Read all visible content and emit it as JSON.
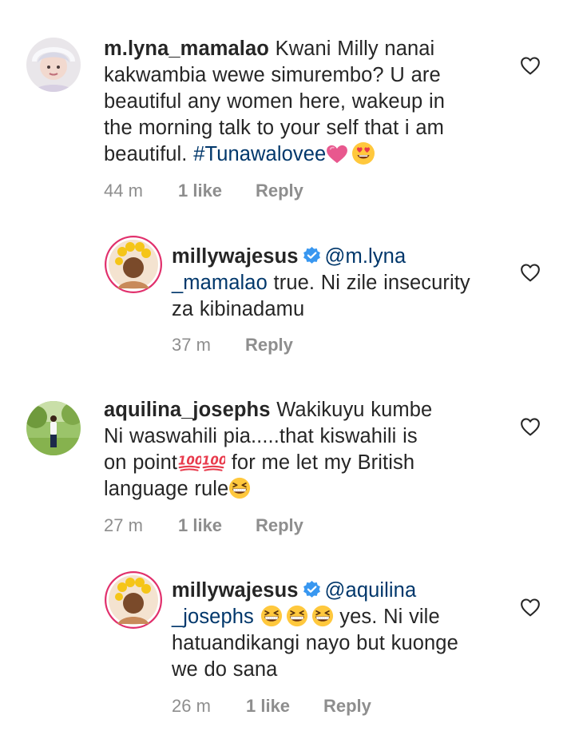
{
  "comments": [
    {
      "username": "m.lyna_mamalao",
      "lines": [
        "Kwani Milly nanai",
        "kakwambia wewe simurembo? U are",
        "beautiful any women here, wakeup in",
        "the morning talk to your self that i am",
        "beautiful."
      ],
      "hashtag": "#Tunawalovee",
      "time": "44 m",
      "likes": "1 like",
      "reply": "Reply"
    },
    {
      "username": "millywajesus",
      "mention": "@m.lyna",
      "mention_cont": "_mamalao",
      "lines": [
        "true. Ni zile insecurity",
        "za kibinadamu"
      ],
      "time": "37 m",
      "reply": "Reply"
    },
    {
      "username": "aquilina_josephs",
      "lines": [
        "Wakikuyu kumbe",
        "Ni waswahili pia.....that kiswahili is",
        "on point",
        "for me let my British",
        "language rule"
      ],
      "time": "27 m",
      "likes": "1 like",
      "reply": "Reply"
    },
    {
      "username": "millywajesus",
      "mention": "@aquilina",
      "mention_cont": "_josephs",
      "lines": [
        "yes. Ni vile",
        "hatuandikangi nayo but kuonge",
        "we do sana"
      ],
      "time": "26 m",
      "likes": "1 like",
      "reply": "Reply"
    }
  ],
  "icons": {
    "like": "heart-outline-icon",
    "verified": "verified-badge-icon",
    "emoji_heart": "pink-heart-emoji",
    "emoji_heart_eyes": "heart-eyes-emoji",
    "emoji_hundred": "hundred-points-emoji",
    "emoji_grin": "grinning-squinting-emoji"
  },
  "colors": {
    "mention": "#00376b",
    "meta": "#8e8e8e",
    "verified": "#3897f0",
    "story_ring": "#e1306c"
  }
}
